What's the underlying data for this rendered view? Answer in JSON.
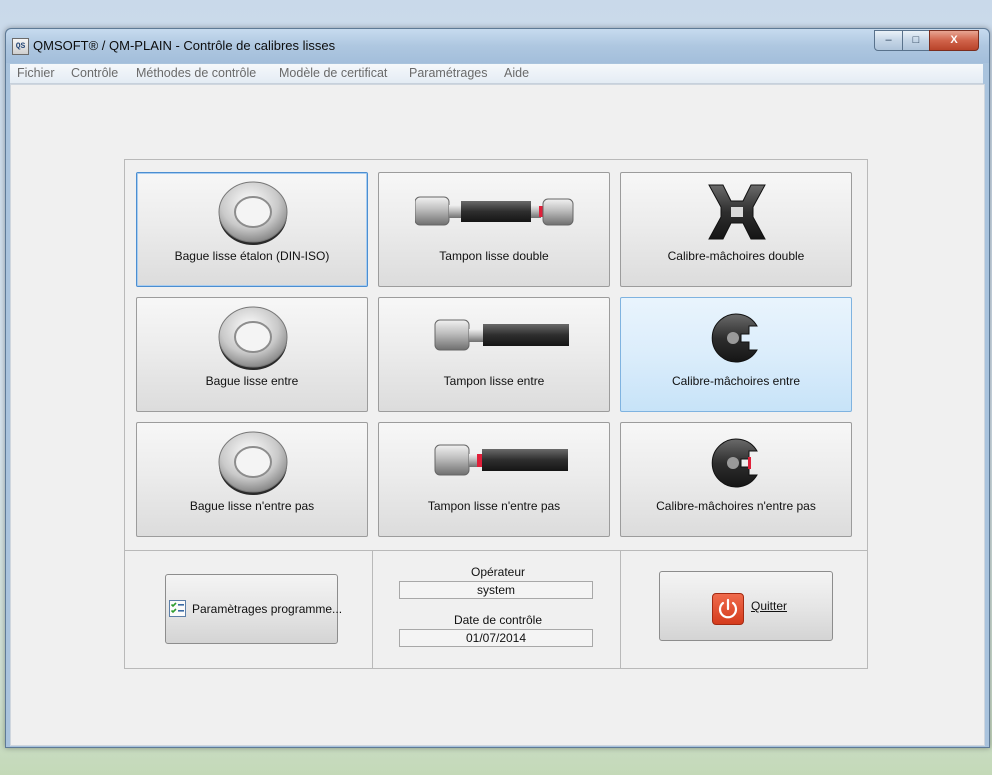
{
  "window": {
    "title": "QMSOFT® / QM-PLAIN - Contrôle de calibres lisses",
    "icon_label": "QS",
    "controls": {
      "minimize": "–",
      "maximize": "□",
      "close": "X"
    }
  },
  "menu": [
    "Fichier",
    "Contrôle",
    "Méthodes de contrôle",
    "Modèle de certificat",
    "Paramétrages",
    "Aide"
  ],
  "tiles": [
    {
      "label": "Bague lisse étalon (DIN-ISO)",
      "icon": "ring-gauge-icon"
    },
    {
      "label": "Tampon lisse double",
      "icon": "double-plug-gauge-icon"
    },
    {
      "label": "Calibre-mâchoires double",
      "icon": "double-snap-gauge-icon"
    },
    {
      "label": "Bague lisse entre",
      "icon": "ring-gauge-icon"
    },
    {
      "label": "Tampon lisse entre",
      "icon": "plug-gauge-go-icon"
    },
    {
      "label": "Calibre-mâchoires entre",
      "icon": "snap-gauge-go-icon"
    },
    {
      "label": "Bague lisse n'entre pas",
      "icon": "ring-gauge-icon"
    },
    {
      "label": "Tampon lisse n'entre pas",
      "icon": "plug-gauge-nogo-icon"
    },
    {
      "label": "Calibre-mâchoires n'entre pas",
      "icon": "snap-gauge-nogo-icon"
    }
  ],
  "settings_button": {
    "label": "Paramètrages programme...",
    "icon": "checklist-icon"
  },
  "operator": {
    "label": "Opérateur",
    "value": "system"
  },
  "control_date": {
    "label": "Date de contrôle",
    "value": "01/07/2014"
  },
  "quit_button": {
    "label": "Quitter",
    "icon": "power-icon"
  },
  "colors": {
    "accent_focus": "#4b8ed1",
    "hover_tile": "#dbedfb",
    "quit_icon": "#d53b1c",
    "nogo_band": "#e0203a"
  }
}
